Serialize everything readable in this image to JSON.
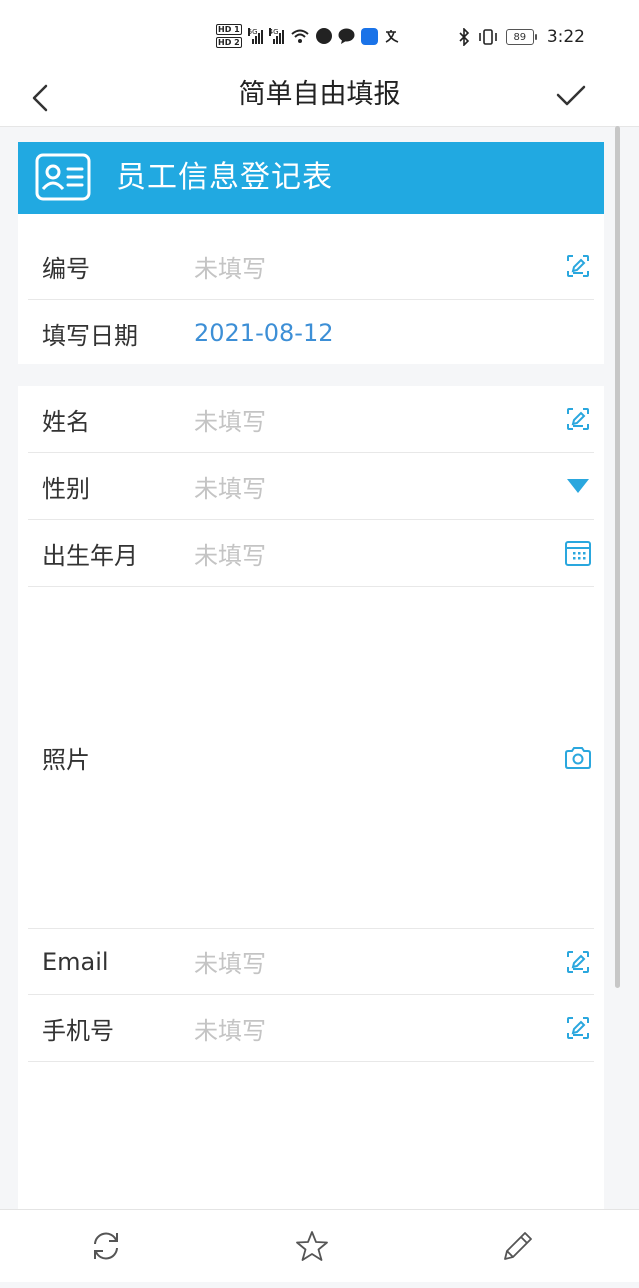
{
  "status_bar": {
    "hd_top": "HD 1",
    "hd_bottom": "HD 2",
    "net1": "5G",
    "net2": "4G",
    "battery": "89",
    "time": "3:22"
  },
  "nav": {
    "title": "简单自由填报",
    "back_icon": "chevron-left-icon",
    "done_icon": "check-icon"
  },
  "form": {
    "title": "员工信息登记表",
    "title_icon": "id-card-icon",
    "accent_color": "#21a9e1"
  },
  "section1": [
    {
      "label": "编号",
      "value": "未填写",
      "filled": false,
      "icon": "edit-icon"
    },
    {
      "label": "填写日期",
      "value": "2021-08-12",
      "filled": true,
      "icon": ""
    }
  ],
  "section2": [
    {
      "label": "姓名",
      "value": "未填写",
      "icon": "edit-icon"
    },
    {
      "label": "性别",
      "value": "未填写",
      "icon": "dropdown-triangle-icon"
    },
    {
      "label": "出生年月",
      "value": "未填写",
      "icon": "calendar-icon"
    },
    {
      "label": "照片",
      "value": "",
      "icon": "camera-icon"
    },
    {
      "label": "Email",
      "value": "未填写",
      "icon": "edit-icon"
    },
    {
      "label": "手机号",
      "value": "未填写",
      "icon": "edit-icon"
    }
  ],
  "bottom_bar": {
    "refresh_icon": "refresh-icon",
    "favorite_icon": "star-icon",
    "edit_icon": "pencil-icon"
  }
}
